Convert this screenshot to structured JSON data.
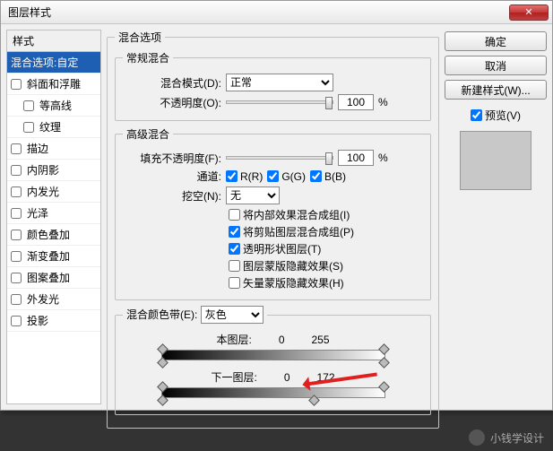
{
  "title": "图层样式",
  "close_glyph": "✕",
  "left": {
    "header": "样式",
    "items": [
      {
        "label": "混合选项:自定",
        "selected": true
      },
      {
        "label": "斜面和浮雕"
      },
      {
        "label": "等高线",
        "indent": true
      },
      {
        "label": "纹理",
        "indent": true
      },
      {
        "label": "描边"
      },
      {
        "label": "内阴影"
      },
      {
        "label": "内发光"
      },
      {
        "label": "光泽"
      },
      {
        "label": "颜色叠加"
      },
      {
        "label": "渐变叠加"
      },
      {
        "label": "图案叠加"
      },
      {
        "label": "外发光"
      },
      {
        "label": "投影"
      }
    ]
  },
  "blend_options_legend": "混合选项",
  "general_legend": "常规混合",
  "blend_mode_label": "混合模式(D):",
  "blend_mode_value": "正常",
  "opacity_label": "不透明度(O):",
  "opacity_value": "100",
  "pct": "%",
  "adv_legend": "高级混合",
  "fill_label": "填充不透明度(F):",
  "fill_value": "100",
  "channels_label": "通道:",
  "ch_r": "R(R)",
  "ch_g": "G(G)",
  "ch_b": "B(B)",
  "knockout_label": "挖空(N):",
  "knockout_value": "无",
  "adv_checks": [
    {
      "label": "将内部效果混合成组(I)",
      "checked": false
    },
    {
      "label": "将剪贴图层混合成组(P)",
      "checked": true
    },
    {
      "label": "透明形状图层(T)",
      "checked": true
    },
    {
      "label": "图层蒙版隐藏效果(S)",
      "checked": false
    },
    {
      "label": "矢量蒙版隐藏效果(H)",
      "checked": false
    }
  ],
  "blendif_legend": "混合颜色带(E):",
  "blendif_value": "灰色",
  "this_layer_label": "本图层:",
  "this_low": "0",
  "this_high": "255",
  "under_layer_label": "下一图层:",
  "under_low": "0",
  "under_high": "172",
  "buttons": {
    "ok": "确定",
    "cancel": "取消",
    "newstyle": "新建样式(W)...",
    "preview": "预览(V)"
  },
  "watermark": "小钱学设计"
}
